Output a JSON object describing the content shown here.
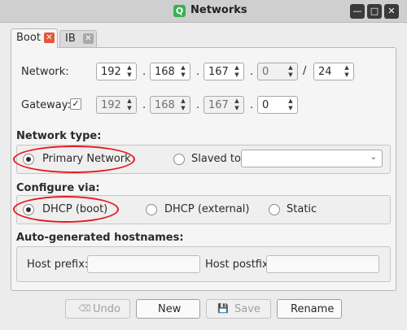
{
  "window": {
    "title": "Networks",
    "app_icon": "Q"
  },
  "tabs": [
    {
      "label": "Boot",
      "active": true
    },
    {
      "label": "IB",
      "active": false
    }
  ],
  "network": {
    "label": "Network:",
    "octets": [
      "192",
      "168",
      "167",
      "0"
    ],
    "prefix": "24",
    "dot": ".",
    "slash": "/"
  },
  "gateway": {
    "label": "Gateway:",
    "checked": true,
    "octets": [
      "192",
      "168",
      "167",
      "0"
    ]
  },
  "network_type": {
    "title": "Network type:",
    "primary_label": "Primary Network",
    "slaved_label": "Slaved to:",
    "slaved_value": ""
  },
  "configure_via": {
    "title": "Configure via:",
    "options": [
      "DHCP (boot)",
      "DHCP (external)",
      "Static"
    ],
    "selected": "DHCP (boot)"
  },
  "hostnames": {
    "title": "Auto-generated hostnames:",
    "prefix_label": "Host prefix:",
    "prefix_value": "",
    "postfix_label": "Host postfix",
    "postfix_value": ""
  },
  "buttons": {
    "undo": "Undo",
    "new": "New",
    "save": "Save",
    "rename": "Rename"
  },
  "colors": {
    "highlight": "#e8181e",
    "tab_close": "#e2583a",
    "app_icon": "#37b24d"
  }
}
